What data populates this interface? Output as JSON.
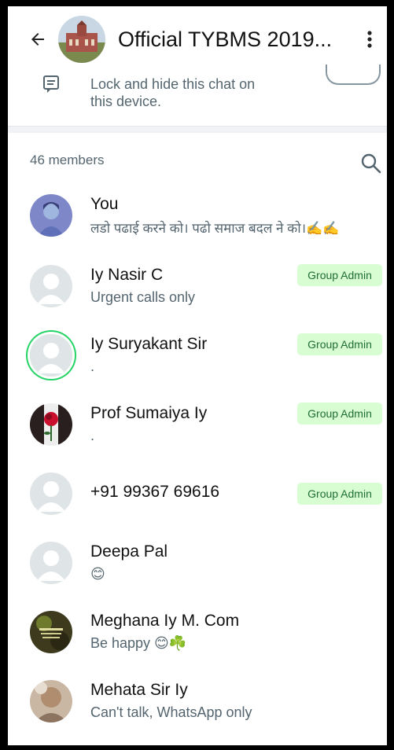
{
  "header": {
    "back_icon": "arrow-left-icon",
    "title": "Official TYBMS 2019...",
    "menu_icon": "more-vert-icon"
  },
  "lock_chat": {
    "icon": "lock-chat-icon",
    "line1": "Lock and hide this chat on",
    "line2": "this device."
  },
  "members": {
    "count_label": "46 members",
    "search_icon": "search-icon",
    "admin_badge_label": "Group Admin",
    "list": [
      {
        "name": "You",
        "status": "लडो पढाई करने को। पढो समाज बदल ने को।✍️✍️",
        "admin": false
      },
      {
        "name": "Iy Nasir C",
        "status": "Urgent calls only",
        "admin": true
      },
      {
        "name": "Iy Suryakant Sir",
        "status": ".",
        "admin": true
      },
      {
        "name": "Prof Sumaiya Iy",
        "status": ".",
        "admin": true
      },
      {
        "name": "+91 99367 69616",
        "status": "",
        "admin": true
      },
      {
        "name": "Deepa Pal",
        "status": "😊",
        "admin": false
      },
      {
        "name": "Meghana Iy M. Com",
        "status": "Be happy 😊☘️",
        "admin": false
      },
      {
        "name": "Mehata Sir Iy",
        "status": "Can't talk, WhatsApp only",
        "admin": false
      }
    ]
  },
  "colors": {
    "accent_green": "#25d366",
    "badge_bg": "#d9fdd3",
    "badge_text": "#1f6e34",
    "secondary_text": "#54656f"
  }
}
